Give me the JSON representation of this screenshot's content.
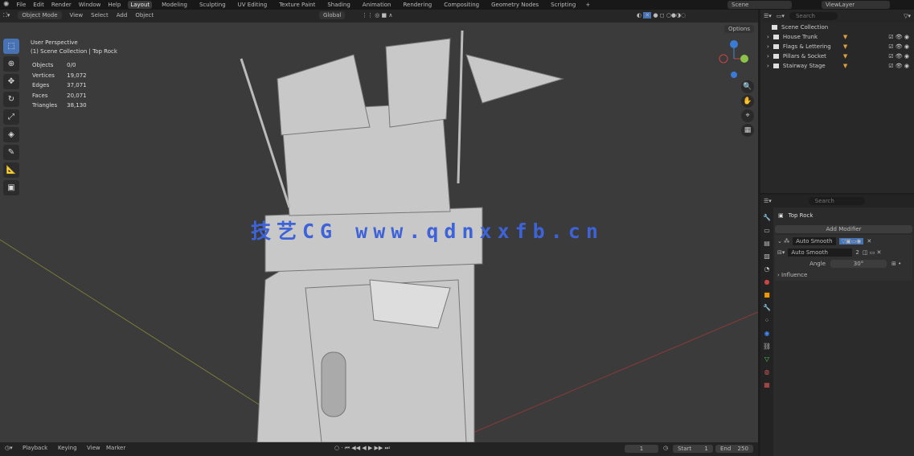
{
  "menu": [
    "File",
    "Edit",
    "Render",
    "Window",
    "Help"
  ],
  "workspaces": [
    "Layout",
    "Modeling",
    "Sculpting",
    "UV Editing",
    "Texture Paint",
    "Shading",
    "Animation",
    "Rendering",
    "Compositing",
    "Geometry Nodes",
    "Scripting"
  ],
  "scene": "Scene",
  "view_layer": "ViewLayer",
  "header": {
    "mode": "Object Mode",
    "view": "View",
    "select": "Select",
    "add": "Add",
    "object": "Object",
    "orientation": "Global",
    "options": "Options"
  },
  "overlay": {
    "view_name": "User Perspective",
    "collection": "(1) Scene Collection | Top Rock",
    "stats": [
      [
        "Objects",
        "0/0"
      ],
      [
        "Vertices",
        "19,072"
      ],
      [
        "Edges",
        "37,071"
      ],
      [
        "Faces",
        "20,071"
      ],
      [
        "Triangles",
        "38,130"
      ]
    ]
  },
  "watermark": "技艺CG www.qdnxxfb.cn",
  "outliner": {
    "search": "Search",
    "root": "Scene Collection",
    "items": [
      "House Trunk",
      "Flags & Lettering",
      "Pillars & Socket",
      "Stairway Stage"
    ]
  },
  "properties": {
    "search": "Search",
    "object": "Top Rock",
    "add_modifier": "Add Modifier",
    "modifier_name": "Auto Smooth",
    "node_group": "Auto Smooth",
    "users": "2",
    "angle_label": "Angle",
    "angle_value": "30°",
    "influence": "Influence"
  },
  "timeline": {
    "playback": "Playback",
    "keying": "Keying",
    "view": "View",
    "marker": "Marker",
    "frame": "1",
    "start_label": "Start",
    "start": "1",
    "end_label": "End",
    "end": "250"
  }
}
